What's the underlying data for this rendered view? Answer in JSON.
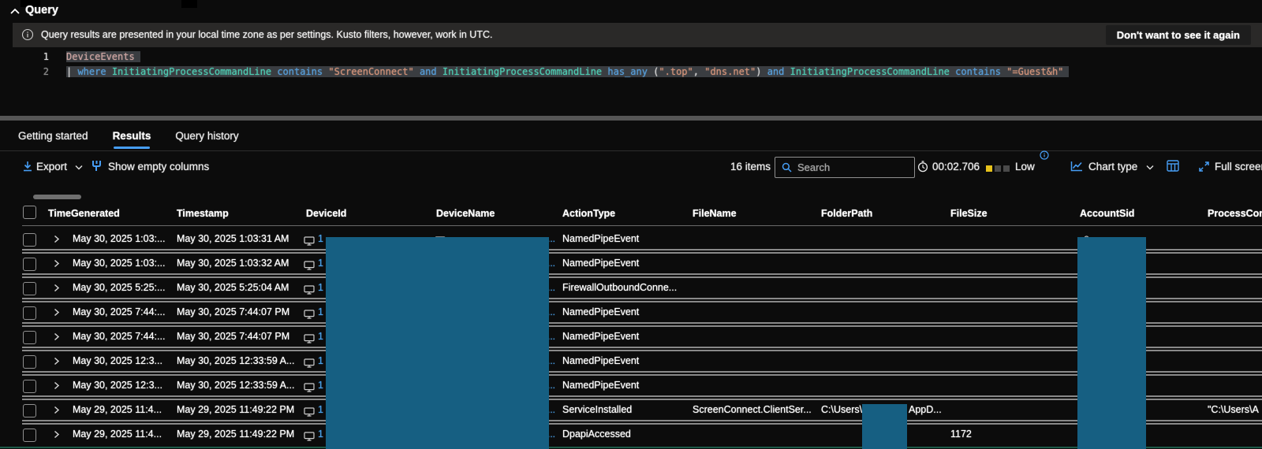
{
  "colors": {
    "accent": "#479ef5",
    "link": "#4ba0e8",
    "redaction": "#165f82",
    "selection": "#3a3d41",
    "syntax": {
      "kw": "#569cd6",
      "ident": "#4ec9b0",
      "str": "#ce9178",
      "punct": "#d4d4d4",
      "table": "#c9a3a0"
    }
  },
  "query_panel": {
    "title": "Query",
    "info_message": "Query results are presented in your local time zone as per settings. Kusto filters, however, work in UTC.",
    "dismiss_button": "Don't want to see it again",
    "code": {
      "line1_number": "1",
      "line2_number": "2",
      "line1_tokens": [
        [
          "DeviceEvents",
          "table"
        ]
      ],
      "line2_tokens": [
        [
          "|",
          "punct"
        ],
        [
          " where",
          "kw"
        ],
        [
          " InitiatingProcessCommandLine",
          "ident"
        ],
        [
          " contains",
          "kw"
        ],
        [
          " \"ScreenConnect\"",
          "str"
        ],
        [
          " and",
          "kw"
        ],
        [
          " InitiatingProcessCommandLine",
          "ident"
        ],
        [
          " has_any",
          "kw"
        ],
        [
          " (",
          "punct"
        ],
        [
          "\".top\"",
          "str"
        ],
        [
          ",",
          "punct"
        ],
        [
          " \"dns.net\"",
          "str"
        ],
        [
          ")",
          "punct"
        ],
        [
          " and",
          "kw"
        ],
        [
          " InitiatingProcessCommandLine",
          "ident"
        ],
        [
          " contains",
          "kw"
        ],
        [
          " \"=Guest&h\"",
          "str"
        ]
      ]
    }
  },
  "tabs": [
    {
      "label": "Getting started",
      "active": false
    },
    {
      "label": "Results",
      "active": true
    },
    {
      "label": "Query history",
      "active": false
    }
  ],
  "toolbar": {
    "export_label": "Export",
    "show_empty_columns_label": "Show empty columns",
    "items_count": "16 items",
    "search_placeholder": "Search",
    "duration": "00:02.706",
    "resource_usage_label": "Low",
    "chart_type_label": "Chart type",
    "full_screen_label": "Full screen"
  },
  "table": {
    "headers": [
      "TimeGenerated",
      "Timestamp",
      "DeviceId",
      "DeviceName",
      "ActionType",
      "FileName",
      "FolderPath",
      "FileSize",
      "AccountSid",
      "ProcessCommandLine"
    ],
    "rows": [
      {
        "tg": "May 30, 2025 1:03:...",
        "ts": "May 30, 2025 1:03:31 AM",
        "did": "1",
        "atype": "NamedPipeEvent",
        "dname_icon": true,
        "asid_icon": true
      },
      {
        "tg": "May 30, 2025 1:03:...",
        "ts": "May 30, 2025 1:03:32 AM",
        "did": "1",
        "atype": "NamedPipeEvent"
      },
      {
        "tg": "May 30, 2025 5:25:...",
        "ts": "May 30, 2025 5:25:04 AM",
        "did": "1",
        "atype": "FirewallOutboundConne..."
      },
      {
        "tg": "May 30, 2025 7:44:...",
        "ts": "May 30, 2025 7:44:07 PM",
        "did": "1",
        "atype": "NamedPipeEvent"
      },
      {
        "tg": "May 30, 2025 7:44:...",
        "ts": "May 30, 2025 7:44:07 PM",
        "did": "1",
        "atype": "NamedPipeEvent"
      },
      {
        "tg": "May 30, 2025 12:3...",
        "ts": "May 30, 2025 12:33:59 A...",
        "did": "1",
        "atype": "NamedPipeEvent"
      },
      {
        "tg": "May 30, 2025 12:3...",
        "ts": "May 30, 2025 12:33:59 A...",
        "did": "1",
        "atype": "NamedPipeEvent"
      },
      {
        "tg": "May 29, 2025 11:4...",
        "ts": "May 29, 2025 11:49:22 PM",
        "did": "1",
        "atype": "ServiceInstalled",
        "fname": "ScreenConnect.ClientSer...",
        "fpath": "C:\\Users\\",
        "fpath2": "AppD...",
        "pcl": "\"C:\\Users\\A"
      },
      {
        "tg": "May 29, 2025 11:4...",
        "ts": "May 29, 2025 11:49:22 PM",
        "did": "1",
        "atype": "DpapiAccessed",
        "fsize": "1172"
      }
    ]
  }
}
